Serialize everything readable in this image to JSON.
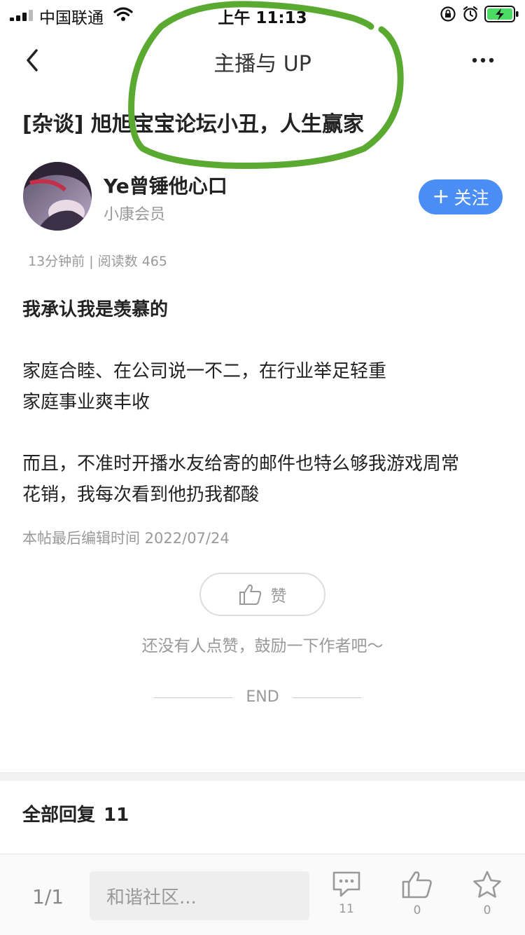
{
  "status_bar": {
    "carrier": "中国联通",
    "time": "上午 11:13"
  },
  "nav": {
    "title": "主播与 UP"
  },
  "post": {
    "title": "[杂谈] 旭旭宝宝论坛小丑，人生赢家",
    "author_name": "Ye曾锤他心口",
    "author_badge": "小康会员",
    "follow_label": "关注",
    "meta": "13分钟前 | 阅读数 465",
    "body": {
      "heading": "我承认我是羡慕的",
      "para1_line1": "家庭合睦、在公司说一不二，在行业举足轻重",
      "para1_line2": "家庭事业爽丰收",
      "para2_line1": "而且，不准时开播水友给寄的邮件也特么够我游戏周常",
      "para2_line2": "花销，我每次看到他扔我都酸"
    },
    "edit_time": "本帖最后编辑时间 2022/07/24",
    "like_label": "赞",
    "like_hint": "还没有人点赞，鼓励一下作者吧～",
    "end_text": "END"
  },
  "replies": {
    "header": "全部回复",
    "count": "11"
  },
  "bottom_bar": {
    "page": "1/1",
    "input_placeholder": "和谐社区...",
    "comment_count": "11",
    "like_count": "0",
    "favorite_count": "0"
  },
  "colors": {
    "accent": "#4a8ef5",
    "annotation": "#5aaa32"
  }
}
